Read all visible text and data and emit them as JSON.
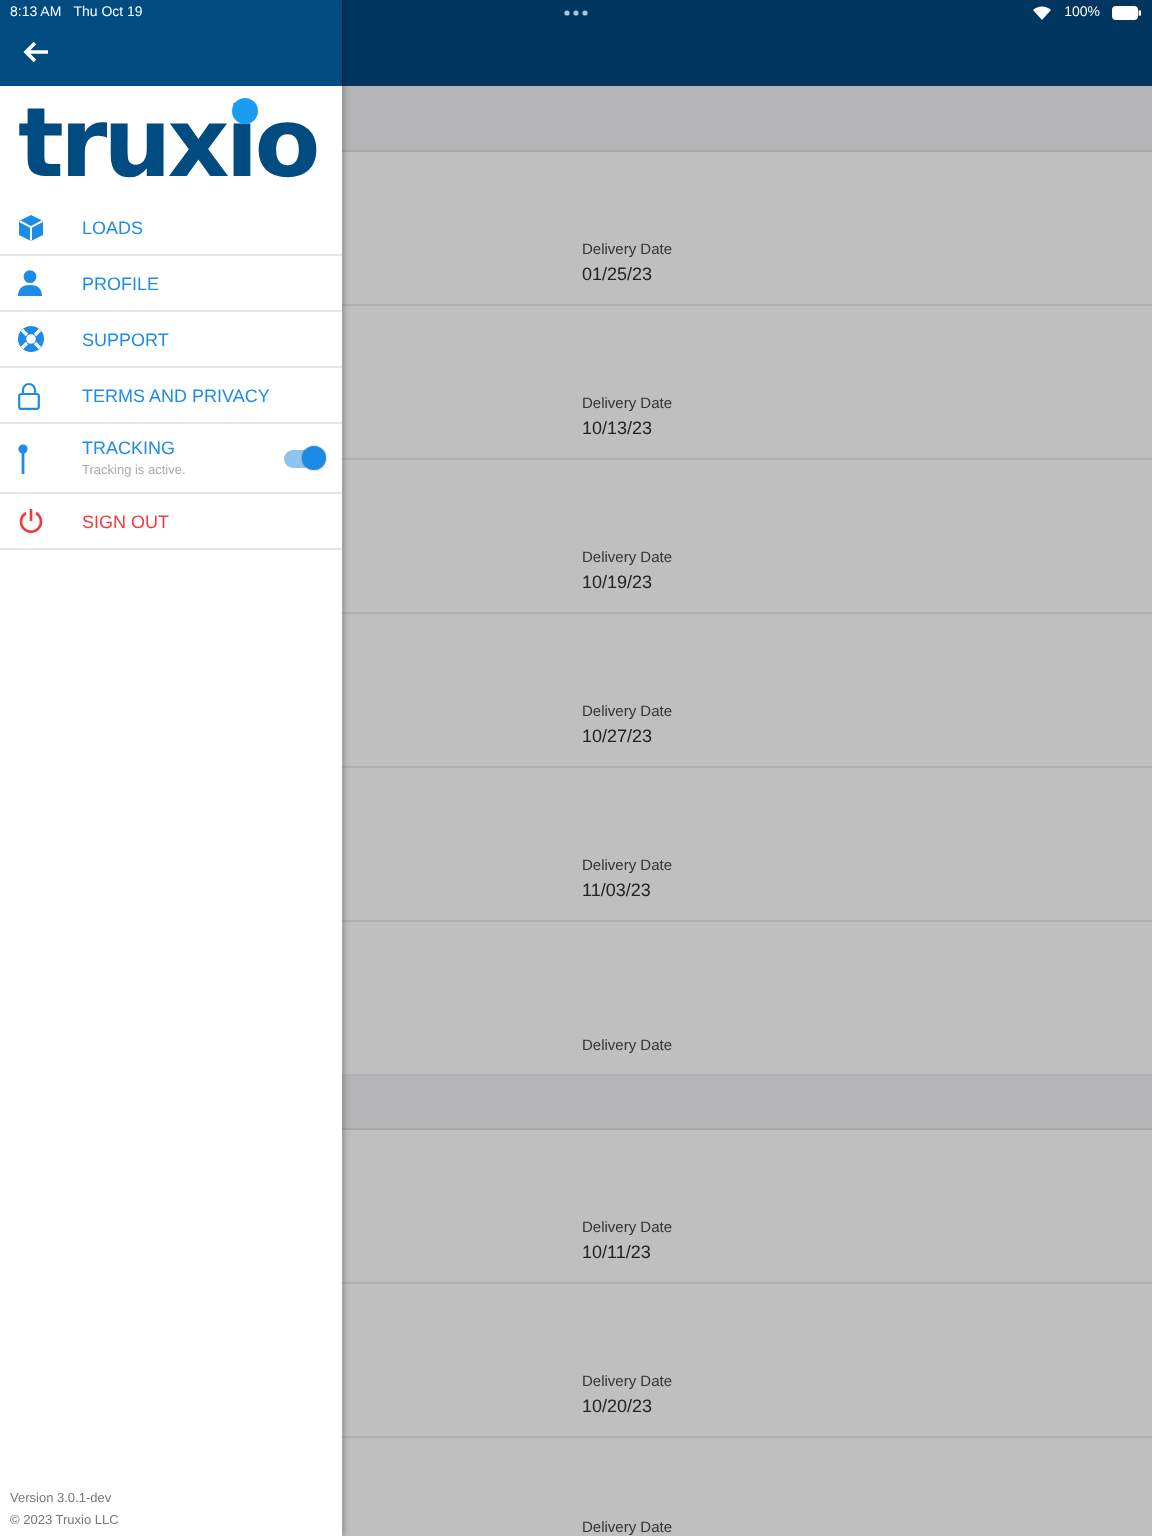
{
  "status_bar": {
    "time": "8:13 AM",
    "date": "Thu Oct 19",
    "battery": "100%"
  },
  "sidebar": {
    "logo": "truxio",
    "items": [
      {
        "kind": "link",
        "label": "LOADS"
      },
      {
        "kind": "link",
        "label": "PROFILE"
      },
      {
        "kind": "link",
        "label": "SUPPORT"
      },
      {
        "kind": "link",
        "label": "TERMS AND PRIVACY"
      },
      {
        "kind": "toggle",
        "label": "TRACKING",
        "subtitle": "Tracking is active.",
        "on": true
      },
      {
        "kind": "danger",
        "label": "SIGN OUT"
      }
    ],
    "version": "Version 3.0.1-dev",
    "copyright": "© 2023 Truxio LLC"
  },
  "sections": [
    {
      "rows": [
        {
          "label": "Delivery Date",
          "date": "01/25/23"
        },
        {
          "label": "Delivery Date",
          "date": "10/13/23"
        },
        {
          "label": "Delivery Date",
          "date": "10/19/23"
        },
        {
          "label": "Delivery Date",
          "date": "10/27/23"
        },
        {
          "label": "Delivery Date",
          "date": "11/03/23"
        },
        {
          "label": "Delivery Date"
        }
      ]
    },
    {
      "rows": [
        {
          "label": "Delivery Date",
          "date": "10/11/23"
        },
        {
          "label": "Delivery Date",
          "date": "10/20/23"
        },
        {
          "label": "Delivery Date"
        }
      ]
    }
  ]
}
